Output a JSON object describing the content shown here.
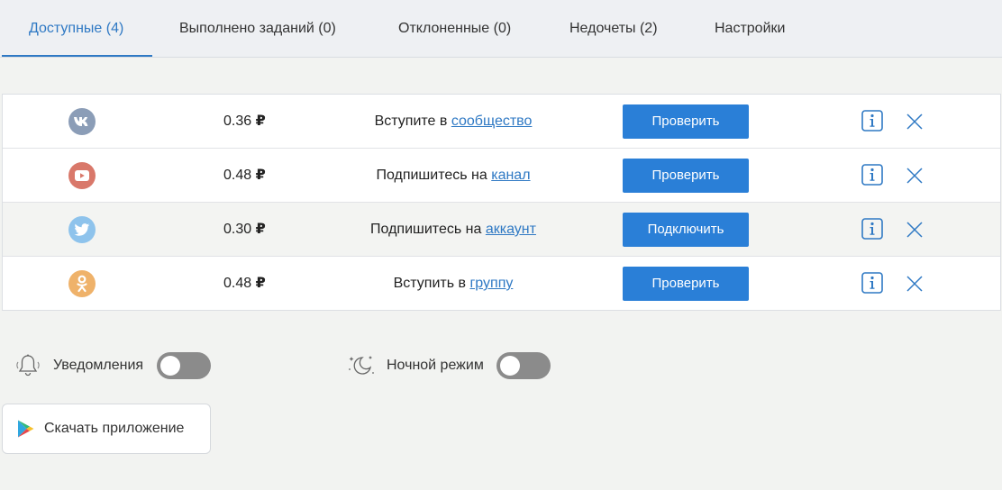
{
  "tabs": [
    {
      "label": "Доступные (4)",
      "active": true
    },
    {
      "label": "Выполнено заданий (0)",
      "active": false
    },
    {
      "label": "Отклоненные (0)",
      "active": false
    },
    {
      "label": "Недочеты (2)",
      "active": false
    },
    {
      "label": "Настройки",
      "active": false
    }
  ],
  "currency_symbol": "₽",
  "tasks": [
    {
      "network_icon": "vk-icon",
      "icon_color": "#8b9db7",
      "price": "0.36",
      "text_prefix": "Вступите в",
      "link_text": "сообщество",
      "button_label": "Проверить"
    },
    {
      "network_icon": "youtube-icon",
      "icon_color": "#d9786a",
      "price": "0.48",
      "text_prefix": "Подпишитесь на",
      "link_text": "канал",
      "button_label": "Проверить"
    },
    {
      "network_icon": "twitter-icon",
      "icon_color": "#8ec3ec",
      "price": "0.30",
      "text_prefix": "Подпишитесь на",
      "link_text": "аккаунт",
      "button_label": "Подключить"
    },
    {
      "network_icon": "odnoklassniki-icon",
      "icon_color": "#efb26a",
      "price": "0.48",
      "text_prefix": "Вступить в",
      "link_text": "группу",
      "button_label": "Проверить"
    }
  ],
  "settings": {
    "notifications_label": "Уведомления",
    "notifications_enabled": false,
    "night_mode_label": "Ночной режим",
    "night_mode_enabled": false
  },
  "download": {
    "label": "Скачать приложение",
    "icon": "google-play-icon"
  },
  "colors": {
    "accent": "#2f79c4",
    "button": "#2a7fd7",
    "toggle_off": "#8b8b8b"
  }
}
